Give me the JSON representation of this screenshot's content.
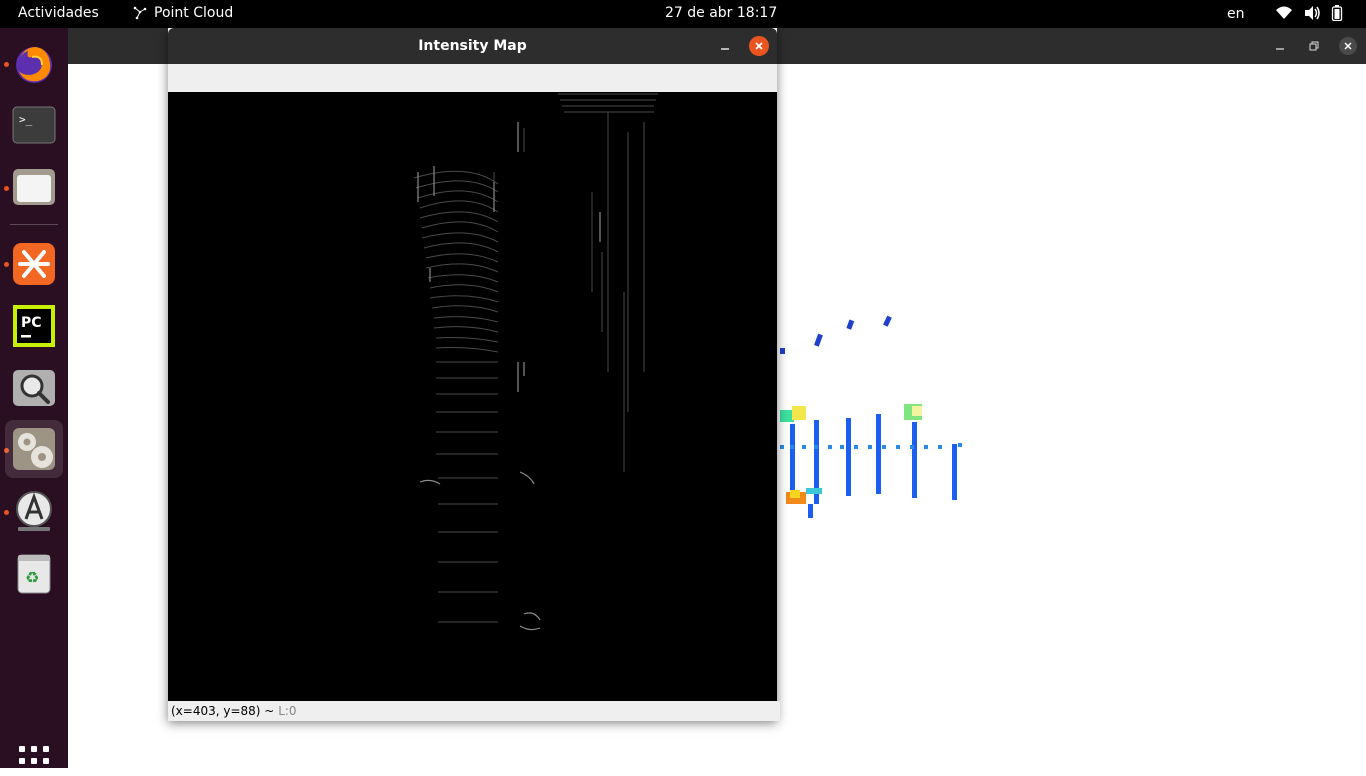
{
  "topbar": {
    "activities": "Actividades",
    "app_name": "Point Cloud",
    "clock": "27 de abr  18:17",
    "language": "en",
    "tray_icons": [
      "wifi-icon",
      "volume-icon",
      "battery-icon"
    ]
  },
  "dock": {
    "items": [
      "firefox",
      "terminal",
      "files",
      "xmind",
      "pycharm",
      "image-viewer",
      "settings",
      "software-updater",
      "trash"
    ],
    "show_apps_icon": "app-grid-icon"
  },
  "dialog": {
    "title": "Intensity Map",
    "status_coords": "(x=403, y=88) ~",
    "status_level": "L:0"
  },
  "colors": {
    "accent": "#e95420",
    "topbar_bg": "#000000",
    "dock_bg": "#2a0e21",
    "titlebar_bg": "#2d2d2d",
    "canvas_bg": "#000000"
  }
}
